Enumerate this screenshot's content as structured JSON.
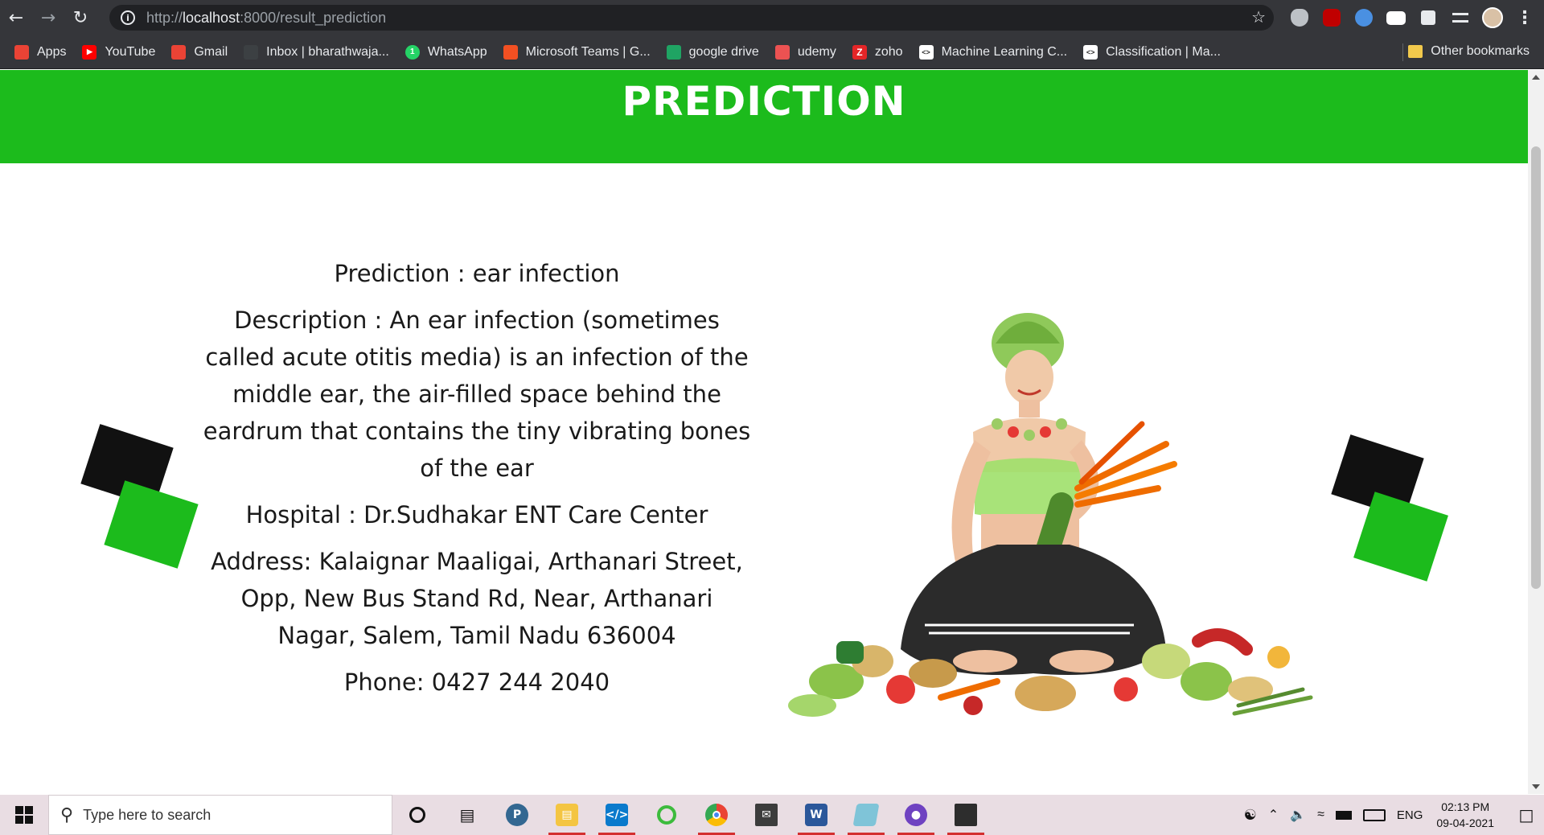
{
  "browser": {
    "url_prefix": "http://",
    "url_host": "localhost",
    "url_rest": ":8000/result_prediction",
    "bookmarks": [
      {
        "label": "Apps",
        "icon": "apps-grid-icon",
        "color": "#ea4335"
      },
      {
        "label": "YouTube",
        "icon": "youtube-icon",
        "color": "#ff0000"
      },
      {
        "label": "Gmail",
        "icon": "gmail-icon",
        "color": "#ea4335"
      },
      {
        "label": "Inbox | bharathwaja...",
        "icon": "inbox-icon",
        "color": "#3c4043"
      },
      {
        "label": "WhatsApp",
        "icon": "whatsapp-icon",
        "color": "#25d366"
      },
      {
        "label": "Microsoft Teams | G...",
        "icon": "ms-windows-icon",
        "color": "#f25022"
      },
      {
        "label": "google drive",
        "icon": "google-drive-icon",
        "color": "#1fa463"
      },
      {
        "label": "udemy",
        "icon": "udemy-icon",
        "color": "#ec5252"
      },
      {
        "label": "zoho",
        "icon": "zoho-icon",
        "color": "#e42527"
      },
      {
        "label": "Machine Learning C...",
        "icon": "code-icon",
        "color": "#ffffff"
      },
      {
        "label": "Classification  |  Ma...",
        "icon": "code-icon",
        "color": "#ffffff"
      }
    ],
    "other_bookmarks": "Other bookmarks"
  },
  "page": {
    "banner_title": "PREDICTION",
    "prediction": "Prediction : ear infection",
    "description": "Description : An ear infection (sometimes called acute otitis media) is an infection of the middle ear, the air-filled space behind the eardrum that contains the tiny vibrating bones of the ear",
    "hospital": "Hospital : Dr.Sudhakar ENT Care Center",
    "address": "Address: Kalaignar Maaligai, Arthanari Street, Opp, New Bus Stand Rd, Near, Arthanari Nagar, Salem, Tamil Nadu 636004",
    "phone": "Phone: 0427 244 2040",
    "colors": {
      "accent_green": "#1cbb1c",
      "black": "#111111"
    }
  },
  "taskbar": {
    "search_placeholder": "Type here to search",
    "language": "ENG",
    "time": "02:13 PM",
    "date": "09-04-2021"
  }
}
